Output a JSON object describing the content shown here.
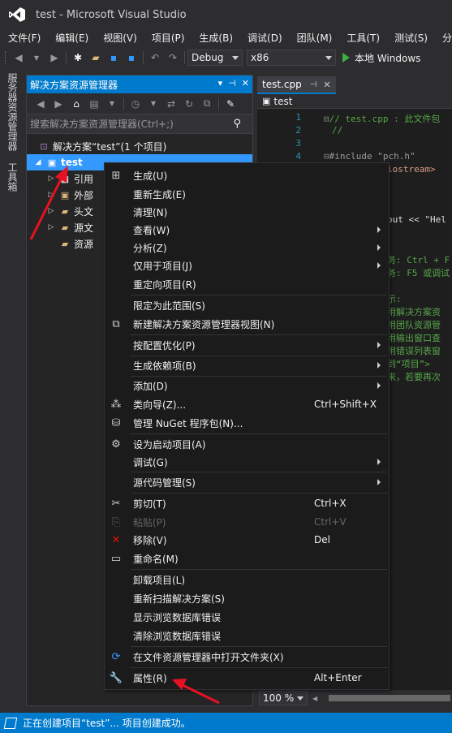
{
  "window": {
    "title": "test - Microsoft Visual Studio"
  },
  "menubar": {
    "items": [
      "文件(F)",
      "编辑(E)",
      "视图(V)",
      "项目(P)",
      "生成(B)",
      "调试(D)",
      "团队(M)",
      "工具(T)",
      "测试(S)",
      "分"
    ]
  },
  "toolbar": {
    "config": "Debug",
    "platform": "x86",
    "run_label": "本地 Windows"
  },
  "vtabs": {
    "server_explorer": "服务器资源管理器",
    "toolbox": "工具箱"
  },
  "solution_explorer": {
    "title": "解决方案资源管理器",
    "search_placeholder": "搜索解决方案资源管理器(Ctrl+;)",
    "solution_label": "解决方案“test”(1 个项目)",
    "project_label": "test",
    "nodes": [
      "引用",
      "外部",
      "头文",
      "源文",
      "资源"
    ]
  },
  "editor": {
    "tab_label": "test.cpp",
    "nav_label": "test",
    "lines": [
      {
        "n": "1",
        "text": "// test.cpp : 此文件包"
      },
      {
        "n": "2",
        "text": "//"
      },
      {
        "n": "3",
        "text": ""
      },
      {
        "n": "4",
        "text": "#include \"pch.h\""
      },
      {
        "frag1": "iostream>"
      },
      {
        "frag2": "out << \"Hel"
      },
      {
        "frag3": "务: Ctrl + F"
      },
      {
        "frag4": "务: F5 或调试"
      },
      {
        "frag5": "示:"
      },
      {
        "frag6": "用解决方案资"
      },
      {
        "frag7": "用团队资源管"
      },
      {
        "frag8": "用输出窗口查"
      },
      {
        "frag9": "用错误列表窗"
      },
      {
        "frag10": "到“项目”>"
      },
      {
        "frag11": "来，若要再次"
      }
    ],
    "zoom": "100 %"
  },
  "context_menu": {
    "items": [
      {
        "label": "生成(U)",
        "icon": "build-icon"
      },
      {
        "label": "重新生成(E)"
      },
      {
        "label": "清理(N)"
      },
      {
        "label": "查看(W)",
        "submenu": true
      },
      {
        "label": "分析(Z)",
        "submenu": true
      },
      {
        "label": "仅用于项目(J)",
        "submenu": true
      },
      {
        "label": "重定向项目(R)"
      },
      {
        "label": "限定为此范围(S)"
      },
      {
        "label": "新建解决方案资源管理器视图(N)",
        "icon": "new-view-icon"
      },
      {
        "label": "按配置优化(P)",
        "submenu": true
      },
      {
        "label": "生成依赖项(B)",
        "submenu": true
      },
      {
        "label": "添加(D)",
        "submenu": true
      },
      {
        "label": "类向导(Z)...",
        "shortcut": "Ctrl+Shift+X",
        "icon": "class-wizard-icon"
      },
      {
        "label": "管理 NuGet 程序包(N)...",
        "icon": "nuget-icon"
      },
      {
        "label": "设为启动项目(A)",
        "icon": "gear-icon"
      },
      {
        "label": "调试(G)",
        "submenu": true
      },
      {
        "label": "源代码管理(S)",
        "submenu": true
      },
      {
        "label": "剪切(T)",
        "shortcut": "Ctrl+X",
        "icon": "scissors-icon"
      },
      {
        "label": "粘贴(P)",
        "shortcut": "Ctrl+V",
        "icon": "paste-icon",
        "disabled": true
      },
      {
        "label": "移除(V)",
        "shortcut": "Del",
        "icon": "remove-icon"
      },
      {
        "label": "重命名(M)",
        "icon": "rename-icon"
      },
      {
        "label": "卸载项目(L)"
      },
      {
        "label": "重新扫描解决方案(S)"
      },
      {
        "label": "显示浏览数据库错误"
      },
      {
        "label": "清除浏览数据库错误"
      },
      {
        "label": "在文件资源管理器中打开文件夹(X)",
        "icon": "open-folder-icon"
      },
      {
        "label": "属性(R)",
        "shortcut": "Alt+Enter",
        "icon": "wrench-icon"
      }
    ]
  },
  "statusbar": {
    "message": "正在创建项目“test”... 项目创建成功。"
  },
  "colors": {
    "accent": "#007acc",
    "selection": "#3399ff",
    "arrow": "#e81123"
  }
}
